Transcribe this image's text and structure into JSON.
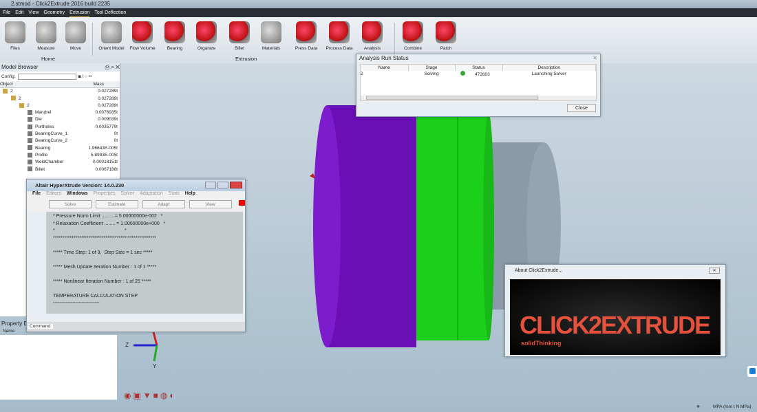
{
  "title": "2.stmod - Click2Extrude 2016 build 2235",
  "menu": [
    "File",
    "Edit",
    "View",
    "Geometry",
    "Extrusion",
    "Tool Deflection"
  ],
  "ribbon": {
    "buttons": [
      "Files",
      "Measure",
      "Move",
      "Orient Model",
      "Flow Volume",
      "Bearing",
      "Organize",
      "Billet",
      "Materials",
      "Press Data",
      "Process Data",
      "Analysis",
      "Combine",
      "Patch"
    ],
    "groups": {
      "home": "Home",
      "extrusion": "Extrusion"
    }
  },
  "browser": {
    "title": "Model Browser",
    "config_label": "Config:",
    "col_object": "Object",
    "col_mass": "Mass",
    "rows": [
      {
        "name": "2",
        "mass": "0.027289t",
        "level": 0,
        "type": "folder"
      },
      {
        "name": "2",
        "mass": "0.027289t",
        "level": 1,
        "type": "folder"
      },
      {
        "name": "2",
        "mass": "0.027289t",
        "level": 2,
        "type": "folder"
      },
      {
        "name": "Mandrel",
        "mass": "0.0076935t",
        "level": 3,
        "type": "part"
      },
      {
        "name": "Die",
        "mass": "0.009039t",
        "level": 3,
        "type": "part"
      },
      {
        "name": "Portholes",
        "mass": "0.0035779t",
        "level": 3,
        "type": "part"
      },
      {
        "name": "BearingCurve_1",
        "mass": "0t",
        "level": 3,
        "type": "part"
      },
      {
        "name": "BearingCurve_2",
        "mass": "0t",
        "level": 3,
        "type": "part"
      },
      {
        "name": "Bearing",
        "mass": "1.96643E-005t",
        "level": 3,
        "type": "part"
      },
      {
        "name": "Profile",
        "mass": "5.8993E-005t",
        "level": 3,
        "type": "part"
      },
      {
        "name": "WeldChamber",
        "mass": "0.00018151t",
        "level": 3,
        "type": "part"
      },
      {
        "name": "Billet",
        "mass": "0.0067188t",
        "level": 3,
        "type": "part"
      }
    ]
  },
  "property": {
    "title": "Property Ed",
    "col_name": "Name",
    "col_value": "Value"
  },
  "hyperxtrude": {
    "title": "Altair HyperXtrude  Version: 14.0.230",
    "menu": [
      "File",
      "Editors",
      "Windows",
      "Properties",
      "Solver",
      "Adaptation",
      "Stats",
      "Help"
    ],
    "buttons": [
      "Solve",
      "Estimate",
      "Adapt",
      "View"
    ],
    "command_label": "Command:",
    "console": "* Pressure Norm Limit ......... = 5.00000000e-002   *\n* Relaxation Coefficient ........ = 1.00000000e+000   *\n*                                                    *\n*******************************************************\n\n***** Time Step: 1 of 9,  Step Size = 1 sec *****\n\n***** Mesh Update Iteration Number : 1 of 1 *****\n\n***** Nonlinear Iteration Number : 1 of 25 *****\n\nTEMPERATURE CALCULATION STEP\n-----------------------------\n\nVELOCITY CALCULATION STEP\n---------------------------"
  },
  "analysis_status": {
    "title": "Analysis Run Status",
    "columns": [
      "Name",
      "Stage",
      "Status",
      "Description"
    ],
    "rows": [
      {
        "name": "2",
        "stage": "Solving",
        "status": "472603",
        "description": "Launching Solver"
      }
    ],
    "close": "Close"
  },
  "about": {
    "title": "About Click2Extrude...",
    "logo_text": "CLICK2EXTRUDE",
    "logo_sub": "solidThinking"
  },
  "axes": {
    "z": "Z",
    "y": "Y"
  },
  "status_units": "MPA (mm t N MPa)",
  "colors": {
    "billet": "#6a0fb5",
    "die": "#1bd01b",
    "mandrel": "#8a9aa8",
    "logo": "#e4513c"
  }
}
